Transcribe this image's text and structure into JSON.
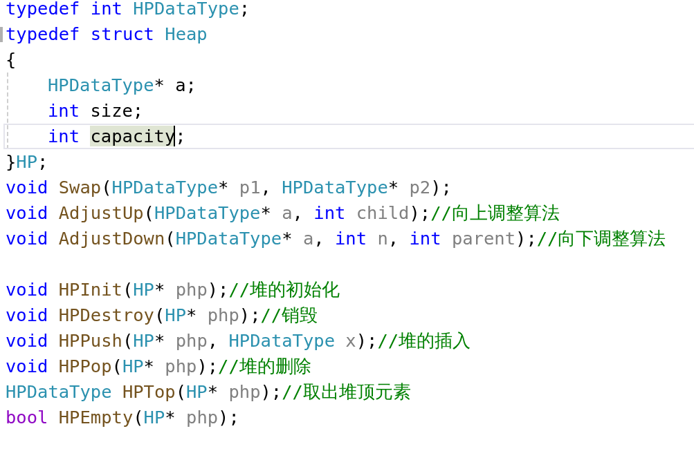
{
  "lines": [
    {
      "kind": "code",
      "tokens": [
        {
          "text": "typedef ",
          "kind": "keyword"
        },
        {
          "text": "int ",
          "kind": "keyword"
        },
        {
          "text": "HPDataType",
          "kind": "type"
        },
        {
          "text": ";",
          "kind": "plain"
        }
      ]
    },
    {
      "kind": "code",
      "marked": true,
      "tokens": [
        {
          "text": "typedef ",
          "kind": "keyword"
        },
        {
          "text": "struct ",
          "kind": "keyword"
        },
        {
          "text": "Heap",
          "kind": "type"
        }
      ]
    },
    {
      "kind": "code",
      "tokens": [
        {
          "text": "{",
          "kind": "plain"
        }
      ],
      "children": [
        {
          "kind": "code",
          "tokens": [
            {
              "text": "HPDataType",
              "kind": "type"
            },
            {
              "text": "* a;",
              "kind": "plain"
            }
          ]
        },
        {
          "kind": "code",
          "tokens": [
            {
              "text": "int ",
              "kind": "keyword"
            },
            {
              "text": "size;",
              "kind": "plain"
            }
          ]
        },
        {
          "kind": "code",
          "current": true,
          "tokens": [
            {
              "text": "int ",
              "kind": "keyword"
            },
            {
              "text": "capacity",
              "kind": "plain",
              "highlighted": true,
              "caret": true
            },
            {
              "text": ";",
              "kind": "plain"
            }
          ]
        }
      ]
    },
    {
      "kind": "code",
      "tokens": [
        {
          "text": "}",
          "kind": "plain"
        },
        {
          "text": "HP",
          "kind": "type"
        },
        {
          "text": ";",
          "kind": "plain"
        }
      ]
    },
    {
      "kind": "code",
      "tokens": [
        {
          "text": "void ",
          "kind": "keyword"
        },
        {
          "text": "Swap",
          "kind": "function"
        },
        {
          "text": "(",
          "kind": "plain"
        },
        {
          "text": "HPDataType",
          "kind": "type"
        },
        {
          "text": "* ",
          "kind": "plain"
        },
        {
          "text": "p1",
          "kind": "param"
        },
        {
          "text": ", ",
          "kind": "plain"
        },
        {
          "text": "HPDataType",
          "kind": "type"
        },
        {
          "text": "* ",
          "kind": "plain"
        },
        {
          "text": "p2",
          "kind": "param"
        },
        {
          "text": ");",
          "kind": "plain"
        }
      ]
    },
    {
      "kind": "code",
      "tokens": [
        {
          "text": "void ",
          "kind": "keyword"
        },
        {
          "text": "AdjustUp",
          "kind": "function"
        },
        {
          "text": "(",
          "kind": "plain"
        },
        {
          "text": "HPDataType",
          "kind": "type"
        },
        {
          "text": "* ",
          "kind": "plain"
        },
        {
          "text": "a",
          "kind": "param"
        },
        {
          "text": ", ",
          "kind": "plain"
        },
        {
          "text": "int ",
          "kind": "keyword"
        },
        {
          "text": "child",
          "kind": "param"
        },
        {
          "text": ");",
          "kind": "plain"
        },
        {
          "text": "//向上调整算法",
          "kind": "comment"
        }
      ]
    },
    {
      "kind": "code",
      "tokens": [
        {
          "text": "void ",
          "kind": "keyword"
        },
        {
          "text": "AdjustDown",
          "kind": "function"
        },
        {
          "text": "(",
          "kind": "plain"
        },
        {
          "text": "HPDataType",
          "kind": "type"
        },
        {
          "text": "* ",
          "kind": "plain"
        },
        {
          "text": "a",
          "kind": "param"
        },
        {
          "text": ", ",
          "kind": "plain"
        },
        {
          "text": "int ",
          "kind": "keyword"
        },
        {
          "text": "n",
          "kind": "param"
        },
        {
          "text": ", ",
          "kind": "plain"
        },
        {
          "text": "int ",
          "kind": "keyword"
        },
        {
          "text": "parent",
          "kind": "param"
        },
        {
          "text": ");",
          "kind": "plain"
        },
        {
          "text": "//向下调整算法",
          "kind": "comment"
        }
      ]
    },
    {
      "kind": "blank"
    },
    {
      "kind": "code",
      "tokens": [
        {
          "text": "void ",
          "kind": "keyword"
        },
        {
          "text": "HPInit",
          "kind": "function"
        },
        {
          "text": "(",
          "kind": "plain"
        },
        {
          "text": "HP",
          "kind": "type"
        },
        {
          "text": "* ",
          "kind": "plain"
        },
        {
          "text": "php",
          "kind": "param"
        },
        {
          "text": ");",
          "kind": "plain"
        },
        {
          "text": "//堆的初始化",
          "kind": "comment"
        }
      ]
    },
    {
      "kind": "code",
      "tokens": [
        {
          "text": "void ",
          "kind": "keyword"
        },
        {
          "text": "HPDestroy",
          "kind": "function"
        },
        {
          "text": "(",
          "kind": "plain"
        },
        {
          "text": "HP",
          "kind": "type"
        },
        {
          "text": "* ",
          "kind": "plain"
        },
        {
          "text": "php",
          "kind": "param"
        },
        {
          "text": ");",
          "kind": "plain"
        },
        {
          "text": "//销毁",
          "kind": "comment"
        }
      ]
    },
    {
      "kind": "code",
      "tokens": [
        {
          "text": "void ",
          "kind": "keyword"
        },
        {
          "text": "HPPush",
          "kind": "function"
        },
        {
          "text": "(",
          "kind": "plain"
        },
        {
          "text": "HP",
          "kind": "type"
        },
        {
          "text": "* ",
          "kind": "plain"
        },
        {
          "text": "php",
          "kind": "param"
        },
        {
          "text": ", ",
          "kind": "plain"
        },
        {
          "text": "HPDataType ",
          "kind": "type"
        },
        {
          "text": "x",
          "kind": "param"
        },
        {
          "text": ");",
          "kind": "plain"
        },
        {
          "text": "//堆的插入",
          "kind": "comment"
        }
      ]
    },
    {
      "kind": "code",
      "tokens": [
        {
          "text": "void ",
          "kind": "keyword"
        },
        {
          "text": "HPPop",
          "kind": "function"
        },
        {
          "text": "(",
          "kind": "plain"
        },
        {
          "text": "HP",
          "kind": "type"
        },
        {
          "text": "* ",
          "kind": "plain"
        },
        {
          "text": "php",
          "kind": "param"
        },
        {
          "text": ");",
          "kind": "plain"
        },
        {
          "text": "//堆的删除",
          "kind": "comment"
        }
      ]
    },
    {
      "kind": "code",
      "tokens": [
        {
          "text": "HPDataType ",
          "kind": "type"
        },
        {
          "text": "HPTop",
          "kind": "function"
        },
        {
          "text": "(",
          "kind": "plain"
        },
        {
          "text": "HP",
          "kind": "type"
        },
        {
          "text": "* ",
          "kind": "plain"
        },
        {
          "text": "php",
          "kind": "param"
        },
        {
          "text": ");",
          "kind": "plain"
        },
        {
          "text": "//取出堆顶元素",
          "kind": "comment"
        }
      ]
    },
    {
      "kind": "code",
      "tokens": [
        {
          "text": "bool ",
          "kind": "builtin"
        },
        {
          "text": "HPEmpty",
          "kind": "function"
        },
        {
          "text": "(",
          "kind": "plain"
        },
        {
          "text": "HP",
          "kind": "type"
        },
        {
          "text": "* ",
          "kind": "plain"
        },
        {
          "text": "php",
          "kind": "param"
        },
        {
          "text": ");",
          "kind": "plain"
        }
      ]
    }
  ]
}
